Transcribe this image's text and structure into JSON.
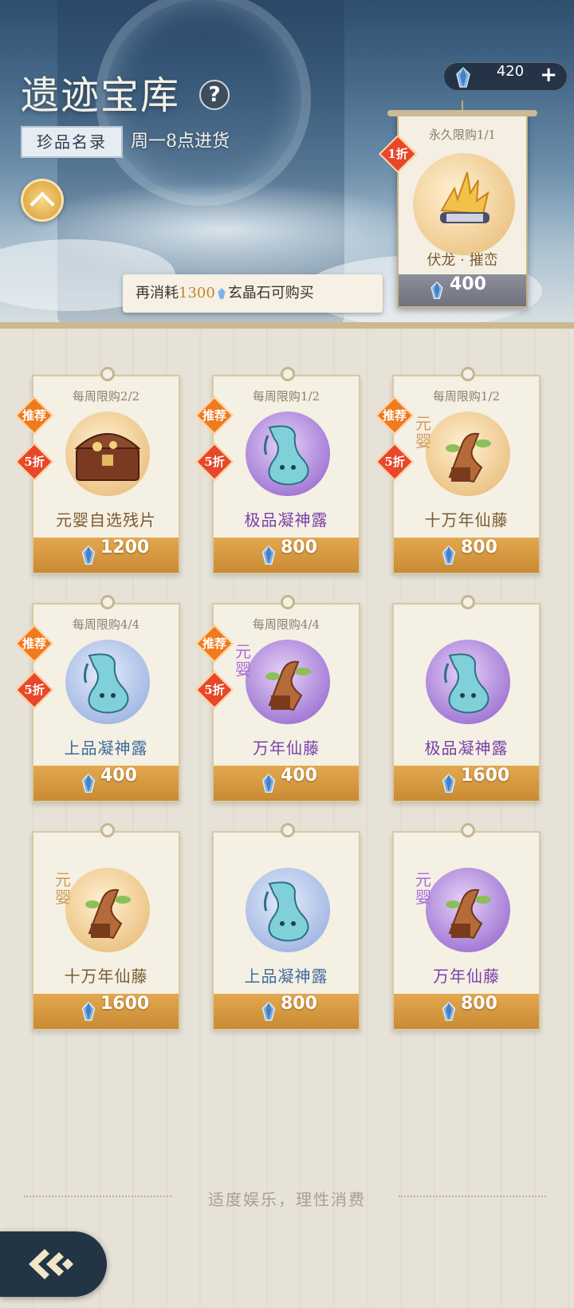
{
  "header": {
    "title": "遗迹宝库",
    "help_icon": "question-icon",
    "catalog_label": "珍品名录",
    "restock_text": "周一8点进货",
    "currency": {
      "icon": "crystal-gem-icon",
      "amount": "420",
      "add_icon": "plus-icon"
    },
    "notice": {
      "prefix": "再消耗",
      "amount": "1300",
      "suffix": "玄晶石可购买"
    }
  },
  "featured": {
    "limit": "永久限购1/1",
    "discount": "1折",
    "name": "伏龙 · 摧峦",
    "price": "400"
  },
  "colors": {
    "accent": "#d99a32",
    "discount": "#e8472a",
    "recommend": "#f07a1e"
  },
  "items": [
    {
      "limit": "每周限购2/2",
      "recommend": "推荐",
      "discount": "5折",
      "name": "元婴自选残片",
      "price": "1200",
      "stamp": "",
      "tone": "gold"
    },
    {
      "limit": "每周限购1/2",
      "recommend": "推荐",
      "discount": "5折",
      "name": "极品凝神露",
      "price": "800",
      "stamp": "",
      "tone": "purple"
    },
    {
      "limit": "每周限购1/2",
      "recommend": "推荐",
      "discount": "5折",
      "name": "十万年仙藤",
      "price": "800",
      "stamp": "元婴",
      "tone": "gold"
    },
    {
      "limit": "每周限购4/4",
      "recommend": "推荐",
      "discount": "5折",
      "name": "上品凝神露",
      "price": "400",
      "stamp": "",
      "tone": "blue"
    },
    {
      "limit": "每周限购4/4",
      "recommend": "推荐",
      "discount": "5折",
      "name": "万年仙藤",
      "price": "400",
      "stamp": "元婴",
      "tone": "purple"
    },
    {
      "limit": "",
      "recommend": "",
      "discount": "",
      "name": "极品凝神露",
      "price": "1600",
      "stamp": "",
      "tone": "purple"
    },
    {
      "limit": "",
      "recommend": "",
      "discount": "",
      "name": "十万年仙藤",
      "price": "1600",
      "stamp": "元婴",
      "tone": "gold"
    },
    {
      "limit": "",
      "recommend": "",
      "discount": "",
      "name": "上品凝神露",
      "price": "800",
      "stamp": "",
      "tone": "blue"
    },
    {
      "limit": "",
      "recommend": "",
      "discount": "",
      "name": "万年仙藤",
      "price": "800",
      "stamp": "元婴",
      "tone": "purple"
    }
  ],
  "footer": {
    "text": "适度娱乐，理性消费"
  },
  "nav": {
    "back_icon": "back-arrow-icon"
  }
}
